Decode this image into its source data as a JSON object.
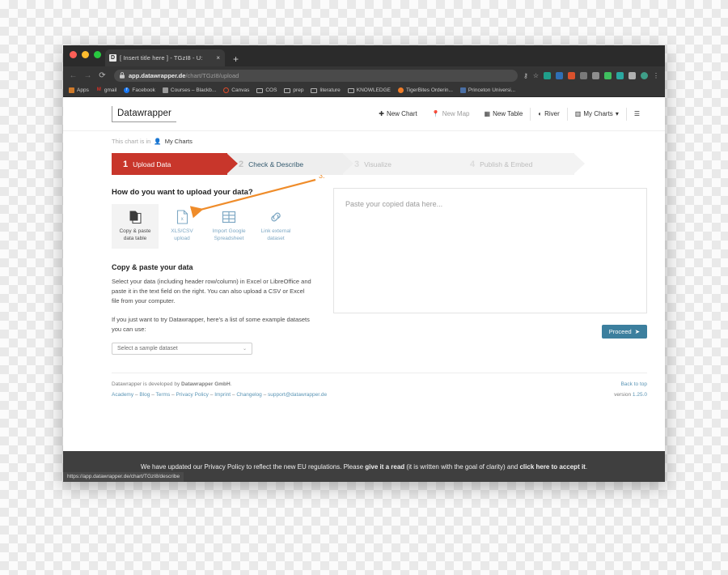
{
  "browser": {
    "tab": {
      "favicon_letter": "D",
      "title": "[ Insert title here ] - TGzI8 - U:",
      "close_icon": "×"
    },
    "new_tab_icon": "+",
    "nav": {
      "back_icon": "←",
      "forward_icon": "→",
      "reload_icon": "⟳"
    },
    "omnibox": {
      "lock_icon": "🔒",
      "url_domain": "app.datawrapper.de",
      "url_path": "/chart/TGzI8/upload"
    },
    "toolbar_icons": [
      "key-icon",
      "star-icon"
    ],
    "extensions": [
      "mail-ext",
      "translate-ext",
      "grid-ext",
      "camera-ext",
      "share-ext",
      "plus-ext",
      "image-ext",
      "puzzle-ext",
      "profile-avatar",
      "kebab-menu"
    ],
    "bookmarks": [
      {
        "label": "Apps",
        "icon": "apps-grid-icon"
      },
      {
        "label": "gmail",
        "icon": "gmail-icon"
      },
      {
        "label": "Facebook",
        "icon": "facebook-icon"
      },
      {
        "label": "Courses – Blackb...",
        "icon": "blackboard-icon"
      },
      {
        "label": "Canvas",
        "icon": "canvas-icon"
      },
      {
        "label": "COS",
        "icon": "folder-icon"
      },
      {
        "label": "prep",
        "icon": "folder-icon"
      },
      {
        "label": "literature",
        "icon": "folder-icon"
      },
      {
        "label": "KNOWLEDGE",
        "icon": "folder-icon"
      },
      {
        "label": "TigerBites Orderin...",
        "icon": "tigerbites-icon"
      },
      {
        "label": "Princeton Universi...",
        "icon": "princeton-icon"
      }
    ],
    "status_url": "https://app.datawrapper.de/chart/TGzI8/describe"
  },
  "app": {
    "logo": "Datawrapper",
    "nav": [
      {
        "label": "New Chart",
        "icon": "plus-icon",
        "dimmed": false
      },
      {
        "label": "New Map",
        "icon": "pin-icon",
        "dimmed": true
      },
      {
        "label": "New Table",
        "icon": "table-icon",
        "dimmed": false
      },
      {
        "label": "River",
        "icon": "river-icon",
        "dimmed": false
      },
      {
        "label": "My Charts",
        "icon": "bars-icon",
        "dimmed": false,
        "caret": "▾"
      },
      {
        "label": "",
        "icon": "hamburger-icon",
        "dimmed": false
      }
    ],
    "breadcrumb": {
      "prefix": "This chart is in",
      "person_icon": "person-icon",
      "location": "My Charts"
    },
    "steps": [
      {
        "num": "1",
        "label": "Upload Data",
        "state": "active"
      },
      {
        "num": "2",
        "label": "Check & Describe",
        "state": "next"
      },
      {
        "num": "3",
        "label": "Visualize",
        "state": "disabled"
      },
      {
        "num": "4",
        "label": "Publish & Embed",
        "state": "disabled"
      }
    ],
    "upload": {
      "question": "How do you want to upload your data?",
      "methods": [
        {
          "label_line1": "Copy & paste",
          "label_line2": "data table",
          "icon": "copy-paste-icon",
          "selected": true
        },
        {
          "label_line1": "XLS/CSV",
          "label_line2": "upload",
          "icon": "xls-file-icon",
          "selected": false
        },
        {
          "label_line1": "Import Google",
          "label_line2": "Spreadsheet",
          "icon": "google-sheet-icon",
          "selected": false
        },
        {
          "label_line1": "Link external",
          "label_line2": "dataset",
          "icon": "link-chain-icon",
          "selected": false
        }
      ],
      "section_title": "Copy & paste your data",
      "paragraph1": "Select your data (including header row/column) in Excel or LibreOffice and paste it in the text field on the right. You can also upload a CSV or Excel file from your computer.",
      "paragraph2": "If you just want to try Datawrapper, here's a list of some example datasets you can use:",
      "sample_select": {
        "value": "Select a sample dataset",
        "chevron": "⌄"
      },
      "paste_placeholder": "Paste your copied data here...",
      "proceed_label": "Proceed",
      "proceed_arrow": "➤"
    },
    "footer": {
      "credit_prefix": "Datawrapper is developed by",
      "credit_company": "Datawrapper GmbH",
      "credit_suffix": ".",
      "links": [
        "Academy",
        "Blog",
        "Terms",
        "Privacy Policy",
        "Imprint",
        "Changelog",
        "support@datawrapper.de"
      ],
      "link_sep": "–",
      "back_to_top": "Back to top",
      "version_label": "version",
      "version_number": "1.25.0"
    },
    "help_button": "?",
    "privacy_banner": {
      "part1": "We have updated our Privacy Policy to reflect the new EU regulations. Please ",
      "bold1": "give it a read",
      "part2": " (it is written with the goal of clarity) and ",
      "bold2": "click here to accept it",
      "part3": "."
    }
  },
  "annotation": {
    "number": "3.",
    "color": "#ef8c2a"
  }
}
